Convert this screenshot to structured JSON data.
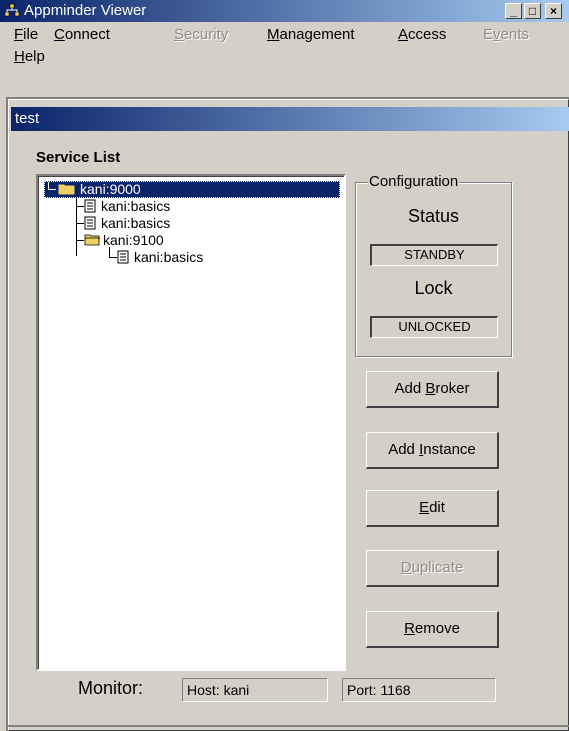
{
  "window": {
    "title": "Appminder Viewer",
    "minimize_glyph": "_",
    "maximize_glyph": "□",
    "close_glyph": "×"
  },
  "menu": [
    {
      "label": "File",
      "mnemonic": "F",
      "rest": "ile",
      "enabled": true
    },
    {
      "label": "Connect",
      "mnemonic": "C",
      "rest": "onnect",
      "enabled": true
    },
    {
      "label": "Security",
      "mnemonic": "S",
      "rest": "ecurity",
      "enabled": false
    },
    {
      "label": "Management",
      "mnemonic": "M",
      "rest": "anagement",
      "enabled": true
    },
    {
      "label": "Access",
      "mnemonic": "A",
      "rest": "ccess",
      "enabled": true
    },
    {
      "label": "Events",
      "mnemonic_pre": "E",
      "mnemonic": "v",
      "rest": "ents",
      "enabled": false
    },
    {
      "label": "Help",
      "mnemonic": "H",
      "rest": "elp",
      "enabled": true
    }
  ],
  "frame": {
    "title": "test"
  },
  "service_list": {
    "label": "Service List",
    "tree": [
      {
        "label": "kani:9000",
        "type": "folder-open",
        "selected": true
      },
      {
        "label": "kani:basics",
        "type": "document",
        "selected": false
      },
      {
        "label": "kani:basics",
        "type": "document",
        "selected": false
      },
      {
        "label": "kani:9100",
        "type": "folder-open",
        "selected": false
      },
      {
        "label": "kani:basics",
        "type": "document",
        "selected": false
      }
    ]
  },
  "configuration": {
    "title": "Configuration",
    "status_label": "Status",
    "status_value": "STANDBY",
    "lock_label": "Lock",
    "lock_value": "UNLOCKED"
  },
  "buttons": {
    "add_broker": {
      "pre": "Add ",
      "mnemonic": "B",
      "post": "roker",
      "enabled": true
    },
    "add_instance": {
      "pre": "Add ",
      "mnemonic": "I",
      "post": "nstance",
      "enabled": true
    },
    "edit": {
      "pre": "",
      "mnemonic": "E",
      "post": "dit",
      "enabled": true
    },
    "duplicate": {
      "pre": "",
      "mnemonic": "D",
      "post": "uplicate",
      "enabled": false
    },
    "remove": {
      "pre": "",
      "mnemonic": "R",
      "post": "emove",
      "enabled": true
    }
  },
  "monitor": {
    "label": "Monitor:",
    "host": "Host: kani",
    "port": "Port: 1168"
  },
  "colors": {
    "title_active": "#0a246a",
    "title_gradient_end": "#a6caf0",
    "face": "#d4d0c8",
    "folder": "#f0d060",
    "selection": "#0a246a"
  }
}
